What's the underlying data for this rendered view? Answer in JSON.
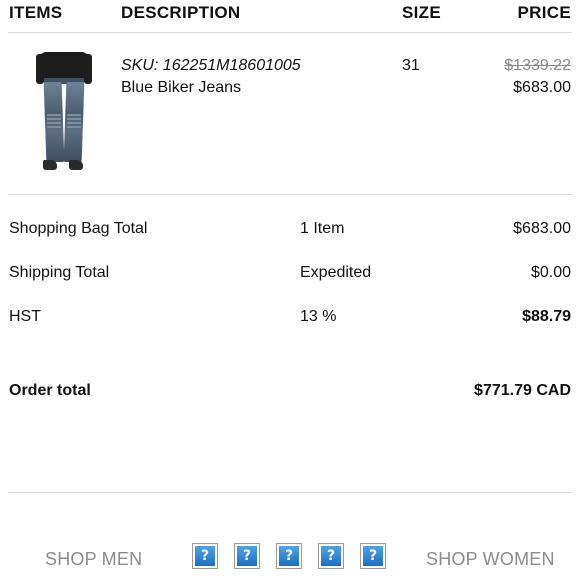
{
  "header": {
    "items": "ITEMS",
    "description": "DESCRIPTION",
    "size": "SIZE",
    "price": "PRICE"
  },
  "item": {
    "sku": "SKU: 162251M18601005",
    "name": "Blue Biker Jeans",
    "size": "31",
    "original_price": "$1339.22",
    "price": "$683.00",
    "image_icon": "jeans-product-image"
  },
  "summary": {
    "bag_total_label": "Shopping Bag Total",
    "bag_total_qty": "1 Item",
    "bag_total_value": "$683.00",
    "shipping_label": "Shipping Total",
    "shipping_method": "Expedited",
    "shipping_value": "$0.00",
    "tax_label": "HST",
    "tax_rate": "13 %",
    "tax_value": "$88.79",
    "order_total_label": "Order total",
    "order_total_value": "$771.79 CAD"
  },
  "footer": {
    "shop_men": "SHOP MEN",
    "shop_women": "SHOP WOMEN",
    "icons": [
      "?",
      "?",
      "?",
      "?",
      "?"
    ]
  },
  "colors": {
    "muted": "#8c8c8c",
    "divider": "#d9d9d9",
    "icon_blue": "#1f6fc0"
  }
}
